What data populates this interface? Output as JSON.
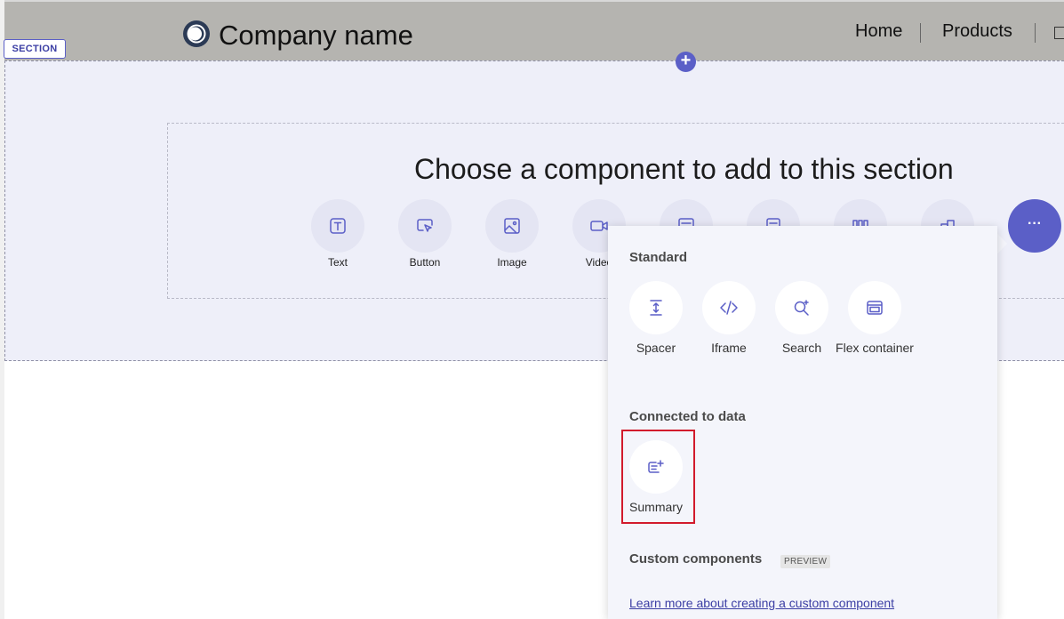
{
  "header": {
    "company_name": "Company name",
    "nav": [
      {
        "label": "Home"
      },
      {
        "label": "Products"
      }
    ]
  },
  "section": {
    "badge": "SECTION",
    "add_button": "+",
    "title": "Choose a component to add to this section",
    "components": [
      {
        "label": "Text",
        "icon": "text-icon"
      },
      {
        "label": "Button",
        "icon": "button-icon"
      },
      {
        "label": "Image",
        "icon": "image-icon"
      },
      {
        "label": "Video",
        "icon": "video-icon"
      },
      {
        "label": "",
        "icon": "form-icon"
      },
      {
        "label": "",
        "icon": "list-icon"
      },
      {
        "label": "",
        "icon": "columns-icon"
      },
      {
        "label": "",
        "icon": "pages-icon"
      }
    ],
    "more_button": "···"
  },
  "popup": {
    "standard_heading": "Standard",
    "standard_items": [
      {
        "label": "Spacer",
        "icon": "spacer-icon"
      },
      {
        "label": "Iframe",
        "icon": "code-icon"
      },
      {
        "label": "Search",
        "icon": "search-icon"
      },
      {
        "label": "Flex container",
        "icon": "flex-container-icon"
      }
    ],
    "connected_heading": "Connected to data",
    "connected_items": [
      {
        "label": "Summary",
        "icon": "summary-icon"
      }
    ],
    "custom_heading": "Custom components",
    "preview_badge": "PREVIEW",
    "learn_link": "Learn more about creating a custom component"
  },
  "colors": {
    "accent": "#5b5fc7",
    "highlight": "#d21b2c",
    "header_bg": "#b5b4b0",
    "section_bg": "#eeeff9"
  }
}
